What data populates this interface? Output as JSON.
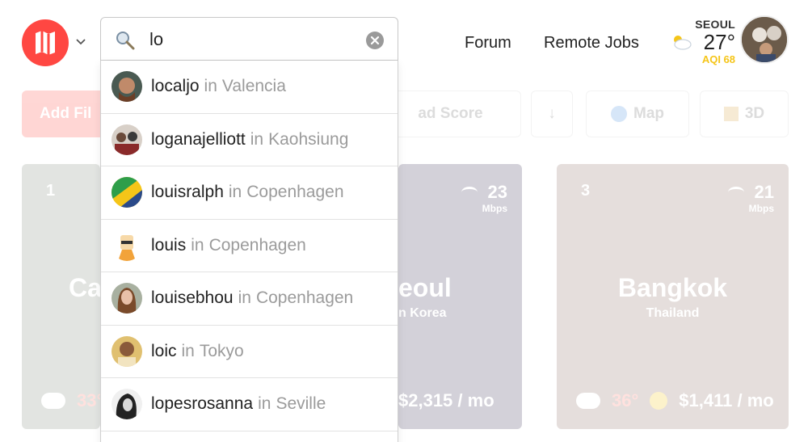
{
  "header": {
    "nav": [
      {
        "label": "Forum"
      },
      {
        "label": "Remote Jobs"
      }
    ],
    "weather": {
      "city": "SEOUL",
      "temp": "27°",
      "aqi": "AQI 68",
      "icon": "partly-cloudy-icon"
    }
  },
  "search": {
    "value": "lo",
    "results": [
      {
        "username": "localjo",
        "in": "in",
        "location": "Valencia",
        "avatar_color": "#8b5a3c"
      },
      {
        "username": "loganajelliott",
        "in": "in",
        "location": "Kaohsiung",
        "avatar_color": "#b0a090"
      },
      {
        "username": "louisralph",
        "in": "in",
        "location": "Copenhagen",
        "avatar_color": "#2e9e4a"
      },
      {
        "username": "louis",
        "in": "in",
        "location": "Copenhagen",
        "avatar_color": "#f2a33a"
      },
      {
        "username": "louisebhou",
        "in": "in",
        "location": "Copenhagen",
        "avatar_color": "#c08a6e"
      },
      {
        "username": "loic",
        "in": "in",
        "location": "Tokyo",
        "avatar_color": "#c9a25a"
      },
      {
        "username": "lopesrosanna",
        "in": "in",
        "location": "Seville",
        "avatar_color": "#333333"
      }
    ]
  },
  "background": {
    "filter_button": "Add Fil",
    "toolbar": [
      {
        "label": "ad Score"
      },
      {
        "label": "↓"
      },
      {
        "label": "Map",
        "icon": "globe-icon"
      },
      {
        "label": "3D",
        "icon": "cube-icon"
      }
    ],
    "cards": [
      {
        "rank": "1",
        "city": "Ca",
        "country": "",
        "speed": "",
        "speed_unit": "",
        "temp": "33°",
        "cost": "",
        "color": "#7d8a7a"
      },
      {
        "rank": "",
        "city": "eoul",
        "country": "n Korea",
        "speed": "23",
        "speed_unit": "Mbps",
        "temp": "",
        "cost": "$2,315 / mo",
        "color": "#3b3356"
      },
      {
        "rank": "3",
        "city": "Bangkok",
        "country": "Thailand",
        "speed": "21",
        "speed_unit": "Mbps",
        "temp": "36°",
        "cost": "$1,411 / mo",
        "color": "#8c6f66"
      }
    ]
  },
  "colors": {
    "brand": "#ff4742",
    "aqi": "#f5c518",
    "muted_text": "#9b9b9b"
  }
}
